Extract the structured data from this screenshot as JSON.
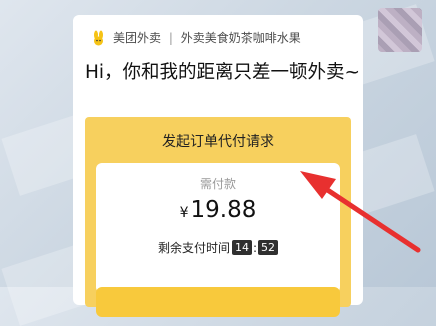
{
  "brand": {
    "name": "美团外卖",
    "sep": "|",
    "tagline": "外卖美食奶茶咖啡水果",
    "logo_icon": "kangaroo-logo-icon",
    "logo_color": "#f6c315"
  },
  "message": {
    "headline": "Hi，你和我的距离只差一顿外卖~"
  },
  "request": {
    "title": "发起订单代付请求",
    "amount_label": "需付款",
    "currency": "¥",
    "amount": "19.88",
    "timer_label": "剩余支付时间",
    "minutes": "14",
    "seconds": "52"
  },
  "colors": {
    "card_bg": "#f7d05e",
    "button": "#f8c93c",
    "arrow": "#e8302f"
  }
}
